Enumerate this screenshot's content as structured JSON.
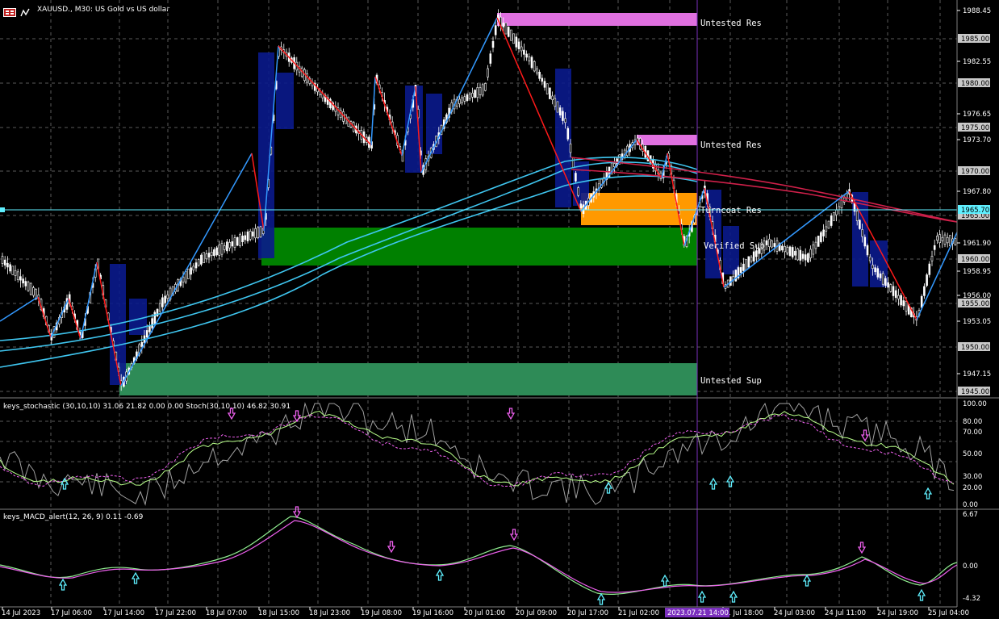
{
  "header": {
    "symbol": "XAUUSD., M30: US Gold vs US dollar"
  },
  "price_axis": {
    "labels": [
      "1988.45",
      "1982.55",
      "1976.65",
      "1973.70",
      "1967.80",
      "1961.90",
      "1958.95",
      "1956.00",
      "1953.05",
      "1947.15"
    ],
    "boxed": [
      "1985.00",
      "1980.00",
      "1975.00",
      "1970.00",
      "1965.00",
      "1960.00",
      "1955.00",
      "1950.00",
      "1945.00"
    ],
    "current": "1965.70"
  },
  "zones": {
    "untested_res_1": "Untested Res",
    "untested_res_2": "Untested Res",
    "turncoat_res": "Turncoat Res",
    "verified_sup": "Verified Sup",
    "untested_sup": "Untested Sup"
  },
  "stoch": {
    "title": "keys_stochastic (30,10,10) 31.06 21.82 0.00 0.00 Stoch(30,10,10) 46.82 30.91",
    "levels": [
      "100.00",
      "80.00",
      "70.00",
      "50.00",
      "30.00",
      "20.00",
      "0.00"
    ]
  },
  "macd": {
    "title": "keys_MACD_alert(12, 26, 9) 0.11 -0.69",
    "levels": [
      "6.67",
      "0.00",
      "-4.32"
    ]
  },
  "time_axis": {
    "labels": [
      "14 Jul 2023",
      "17 Jul 06:00",
      "17 Jul 14:00",
      "17 Jul 22:00",
      "18 Jul 07:00",
      "18 Jul 15:00",
      "18 Jul 23:00",
      "19 Jul 08:00",
      "19 Jul 16:00",
      "20 Jul 01:00",
      "20 Jul 09:00",
      "20 Jul 17:00",
      "21 Jul 02:00",
      "21 Jul 18:00",
      "24 Jul 03:00",
      "24 Jul 11:00",
      "24 Jul 19:00",
      "25 Jul 04:00"
    ],
    "cursor": "2023.07.21 14:00"
  },
  "colors": {
    "bull_candle": "#ffffff",
    "zone_magenta": "#e070e0",
    "zone_orange": "#ff9900",
    "zone_green": "#008000",
    "zone_seagreen": "#2e8b57",
    "zigzag_up": "#3399ff",
    "zigzag_down": "#ff1a1a",
    "ma_cyan": "#3fc6f0",
    "ma_red": "#d0204a",
    "cursor_line": "#7b2fbe",
    "current_price": "#5ff0ff"
  }
}
